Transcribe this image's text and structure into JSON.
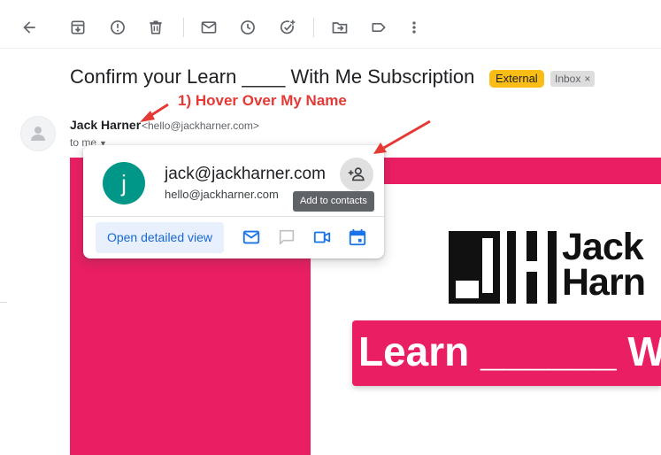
{
  "toolbar": {
    "icons": [
      "back-arrow-icon",
      "archive-icon",
      "report-spam-icon",
      "delete-icon",
      "mark-unread-icon",
      "snooze-icon",
      "add-to-tasks-icon",
      "move-to-icon",
      "label-icon",
      "more-vert-icon"
    ]
  },
  "email": {
    "subject": "Confirm your Learn ____ With Me Subscription",
    "labels": {
      "external": "External",
      "inbox": "Inbox",
      "inbox_remove": "×"
    },
    "sender_name": "Jack Harner",
    "sender_email": "<hello@jackharner.com>",
    "recipient": "to me",
    "recipient_caret": "▼"
  },
  "annotation": {
    "text": "1) Hover Over My Name",
    "color": "#e53935"
  },
  "hovercard": {
    "avatar_letter": "j",
    "name": "jack@jackharner.com",
    "email": "hello@jackharner.com",
    "tooltip": "Add to contacts",
    "open_detailed": "Open detailed view",
    "actions": [
      "email-icon",
      "chat-icon",
      "video-call-icon",
      "calendar-icon"
    ]
  },
  "email_body": {
    "logo_letters": "JH",
    "logo_line1": "Jack",
    "logo_line2": "Harn",
    "banner": "Learn ______ W",
    "brand_color": "#e91e63"
  },
  "colors": {
    "accent_blue": "#1a73e8",
    "external_label": "#f9bd16",
    "avatar_teal": "#009688"
  }
}
